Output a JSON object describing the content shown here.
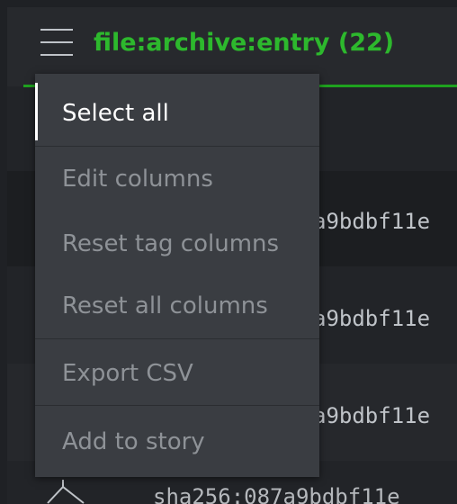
{
  "header": {
    "title": "file:archive:entry (22)"
  },
  "rows": [
    {
      "hash": "a9bdbf11e"
    },
    {
      "hash": "a9bdbf11e"
    },
    {
      "hash": "a9bdbf11e"
    }
  ],
  "bottom_row": {
    "hash": "sha256:087a9bdbf11e"
  },
  "menu": {
    "items": [
      {
        "label": "Select all",
        "active": true
      },
      {
        "label": "Edit columns",
        "active": false
      },
      {
        "label": "Reset tag columns",
        "active": false
      },
      {
        "label": "Reset all columns",
        "active": false
      },
      {
        "label": "Export CSV",
        "active": false
      },
      {
        "label": "Add to story",
        "active": false
      }
    ]
  },
  "colors": {
    "accent": "#2db82d",
    "menu_bg": "#3a3d42",
    "menu_text": "#8e9297",
    "menu_active_text": "#ffffff"
  },
  "icons": [
    "hamburger-icon",
    "graph-node-icon"
  ]
}
